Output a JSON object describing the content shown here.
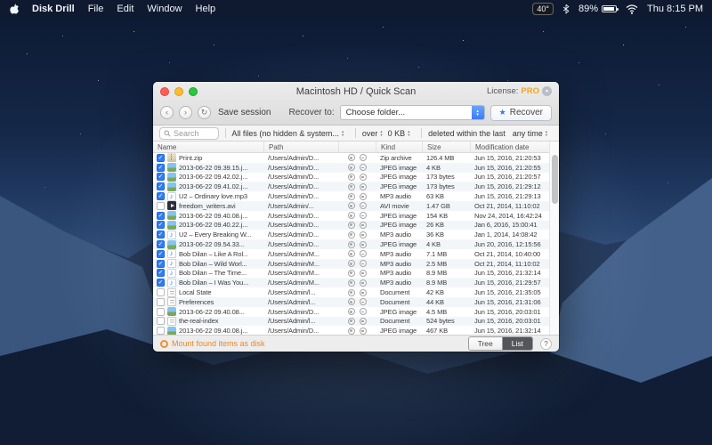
{
  "menu_bar": {
    "items": [
      "Disk Drill",
      "File",
      "Edit",
      "Window",
      "Help"
    ],
    "status": {
      "temperature": "40°",
      "battery": "89%",
      "clock": "Thu 8:15 PM"
    }
  },
  "icons": {
    "back": "‹",
    "forward": "›",
    "rescan": "↻",
    "sort_up": "▴",
    "sort_down": "▾",
    "chevron_down": "▾",
    "recover_star": "★",
    "check": "✓"
  },
  "window": {
    "title": "Macintosh HD / Quick Scan",
    "license_label": "License:",
    "license_value": "PRO",
    "toolbar": {
      "save_session": "Save session",
      "recover_to_label": "Recover to:",
      "choose_folder": "Choose folder...",
      "recover_button": "Recover"
    },
    "filters": {
      "search_placeholder": "Search",
      "file_type_filter": "All files (no hidden & system...",
      "size_over_label": "over",
      "size_value": "0 KB",
      "deleted_label": "deleted within the last",
      "time_value": "any time"
    },
    "table": {
      "columns": [
        "Name",
        "Path",
        "Kind",
        "Size",
        "Modification date"
      ],
      "rows": [
        {
          "checked": true,
          "icon": "zip",
          "name": "Print.zip",
          "path": "/Users/Admin/D...",
          "kind": "Zip archive",
          "size": "126.4 MB",
          "date": "Jun 15, 2016, 21:20:53"
        },
        {
          "checked": true,
          "icon": "image",
          "name": "2013-06-22 09.39.15.j...",
          "path": "/Users/Admin/D...",
          "kind": "JPEG image",
          "size": "4 KB",
          "date": "Jun 15, 2016, 21:20:55"
        },
        {
          "checked": true,
          "icon": "image",
          "name": "2013-06-22 09.42.02.j...",
          "path": "/Users/Admin/D...",
          "kind": "JPEG image",
          "size": "173 bytes",
          "date": "Jun 15, 2016, 21:20:57"
        },
        {
          "checked": true,
          "icon": "image",
          "name": "2013-06-22 09.41.02.j...",
          "path": "/Users/Admin/D...",
          "kind": "JPEG image",
          "size": "173 bytes",
          "date": "Jun 15, 2016, 21:29:12"
        },
        {
          "checked": true,
          "icon": "audio",
          "name": "U2 – Ordinary love.mp3",
          "path": "/Users/Admin/D...",
          "kind": "MP3 audio",
          "size": "63 KB",
          "date": "Jun 15, 2016, 21:29:13"
        },
        {
          "checked": false,
          "icon": "movie",
          "name": "freedom_writers.avi",
          "path": "/Users/Admin/...",
          "kind": "AVI movie",
          "size": "1.47 GB",
          "date": "Oct 21, 2014, 11:10:02"
        },
        {
          "checked": true,
          "icon": "image",
          "name": "2013-06-22 09.40.08.j...",
          "path": "/Users/Admin/D...",
          "kind": "JPEG image",
          "size": "154 KB",
          "date": "Nov 24, 2014, 16:42:24"
        },
        {
          "checked": true,
          "icon": "image",
          "name": "2013-06-22 09.40.22.j...",
          "path": "/Users/Admin/D...",
          "kind": "JPEG image",
          "size": "26 KB",
          "date": "Jan 6, 2016, 15:00:41"
        },
        {
          "checked": true,
          "icon": "audio",
          "name": "U2 – Every Breaking W...",
          "path": "/Users/Admin/D...",
          "kind": "MP3 audio",
          "size": "36 KB",
          "date": "Jan 1, 2014, 14:08:42"
        },
        {
          "checked": true,
          "icon": "image",
          "name": "2013-06-22 09.54.33...",
          "path": "/Users/Admin/D...",
          "kind": "JPEG image",
          "size": "4 KB",
          "date": "Jun 20, 2016, 12:15:56"
        },
        {
          "checked": true,
          "icon": "audio",
          "name": "Bob Dilan – Like A Rol...",
          "path": "/Users/Admin/M...",
          "kind": "MP3 audio",
          "size": "7.1 MB",
          "date": "Oct 21, 2014, 10:40:00"
        },
        {
          "checked": true,
          "icon": "audio",
          "name": "Bob Dilan – Wild Worl...",
          "path": "/Users/Admin/M...",
          "kind": "MP3 audio",
          "size": "2.5 MB",
          "date": "Oct 21, 2014, 11:10:02"
        },
        {
          "checked": true,
          "icon": "audio",
          "name": "Bob Dilan – The Time...",
          "path": "/Users/Admin/M...",
          "kind": "MP3 audio",
          "size": "8.9 MB",
          "date": "Jun 15, 2016, 21:32:14"
        },
        {
          "checked": true,
          "icon": "audio",
          "name": "Bob Dilan – I Was You...",
          "path": "/Users/Admin/M...",
          "kind": "MP3 audio",
          "size": "8.9 MB",
          "date": "Jun 15, 2016, 21:29:57"
        },
        {
          "checked": false,
          "icon": "doc",
          "name": "Local State",
          "path": "/Users/Admin/l...",
          "kind": "Document",
          "size": "42 KB",
          "date": "Jun 15, 2016, 21:35:05"
        },
        {
          "checked": false,
          "icon": "doc",
          "name": "Preferences",
          "path": "/Users/Admin/l...",
          "kind": "Document",
          "size": "44 KB",
          "date": "Jun 15, 2016, 21:31:06"
        },
        {
          "checked": false,
          "icon": "image",
          "name": "2013-06-22 09.40.08...",
          "path": "/Users/Admin/D...",
          "kind": "JPEG image",
          "size": "4.5 MB",
          "date": "Jun 15, 2016, 20:03:01"
        },
        {
          "checked": false,
          "icon": "doc",
          "name": "the-real-index",
          "path": "/Users/Admin/l...",
          "kind": "Document",
          "size": "524 bytes",
          "date": "Jun 15, 2016, 20:03:01"
        },
        {
          "checked": false,
          "icon": "image",
          "name": "2013-06-22 09.40.08.j...",
          "path": "/Users/Admin/D...",
          "kind": "JPEG image",
          "size": "467 KB",
          "date": "Jun 15, 2016, 21:32:14"
        }
      ]
    },
    "footer": {
      "mount_label": "Mount found items as disk",
      "view_tree": "Tree",
      "view_list": "List",
      "help": "?"
    }
  }
}
